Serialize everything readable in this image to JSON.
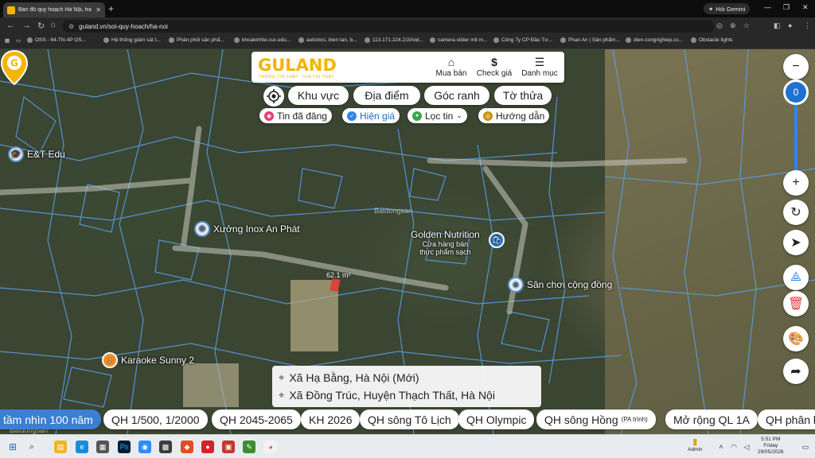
{
  "browser": {
    "tab_title": "Bản đồ quy hoạch Hà Nội, tra c...",
    "gemini_label": "Hỏi Gemini",
    "url": "guland.vn/soi-quy-hoach/ha-noi",
    "bookmarks": [
      "OSS - 64-TN-4P OS...",
      "Hệ thống giám sát t...",
      "Phân phối sản phẩ...",
      "khoakinhte.cuc.edu...",
      "autonics, bien tan, b...",
      "113.171.224.210/vid...",
      "camera-slider mit m...",
      "Công Ty CP Đầu Tư...",
      "Phan An | Sản phẩm...",
      "dien-congnghiep.co...",
      "Obstacle lights"
    ]
  },
  "header": {
    "logo": "GULAND",
    "tagline": "THÔNG TIN THẬT - GIÁ TRỊ THẬT",
    "nav": [
      {
        "label": "Mua bán",
        "icon": "house-icon"
      },
      {
        "label": "Check giá",
        "icon": "dollar-icon"
      },
      {
        "label": "Danh mục",
        "icon": "menu-icon"
      }
    ]
  },
  "search_tabs": [
    "Khu vực",
    "Địa điểm",
    "Góc ranh",
    "Tờ thửa"
  ],
  "filters": [
    {
      "label": "Tin đã đăng",
      "color": "#e53d6f"
    },
    {
      "label": "Hiện giá",
      "color": "#2f86e8"
    },
    {
      "label": "Lọc tin",
      "color": "#3aa64c"
    },
    {
      "label": "Hướng dẫn",
      "color": "#c9920b"
    }
  ],
  "zoom_level": "0",
  "map": {
    "pois": {
      "et_edu": "E&T Edu",
      "xuong_inox": "Xưởng Inox An Phát",
      "golden": "Golden Nutrition",
      "golden_sub1": "Cửa hàng bán",
      "golden_sub2": "thực phẩm sạch",
      "san_choi": "Sân chơi cộng đồng",
      "karaoke": "Karaoke Sunny 2"
    },
    "plot_area": "62.1 m²",
    "watermark": "Batdongsan"
  },
  "address": {
    "new": "Xã Hạ Bằng, Hà Nội (Mới)",
    "old": "Xã Đồng Trúc, Huyện Thạch Thất, Hà Nội"
  },
  "plans": [
    "tầm nhìn 100 năm",
    "QH 1/500, 1/2000",
    "QH 2045-2065",
    "KH 2026",
    "QH sông Tô Lịch",
    "QH Olympic",
    "QH sông Hồng",
    "Mở rộng QL 1A",
    "QH phân l"
  ],
  "plan_note": "(PA trình)",
  "taskbar": {
    "user": "Admin",
    "time": "5:51 PM",
    "day": "Friday",
    "date": "29/05/2026"
  }
}
